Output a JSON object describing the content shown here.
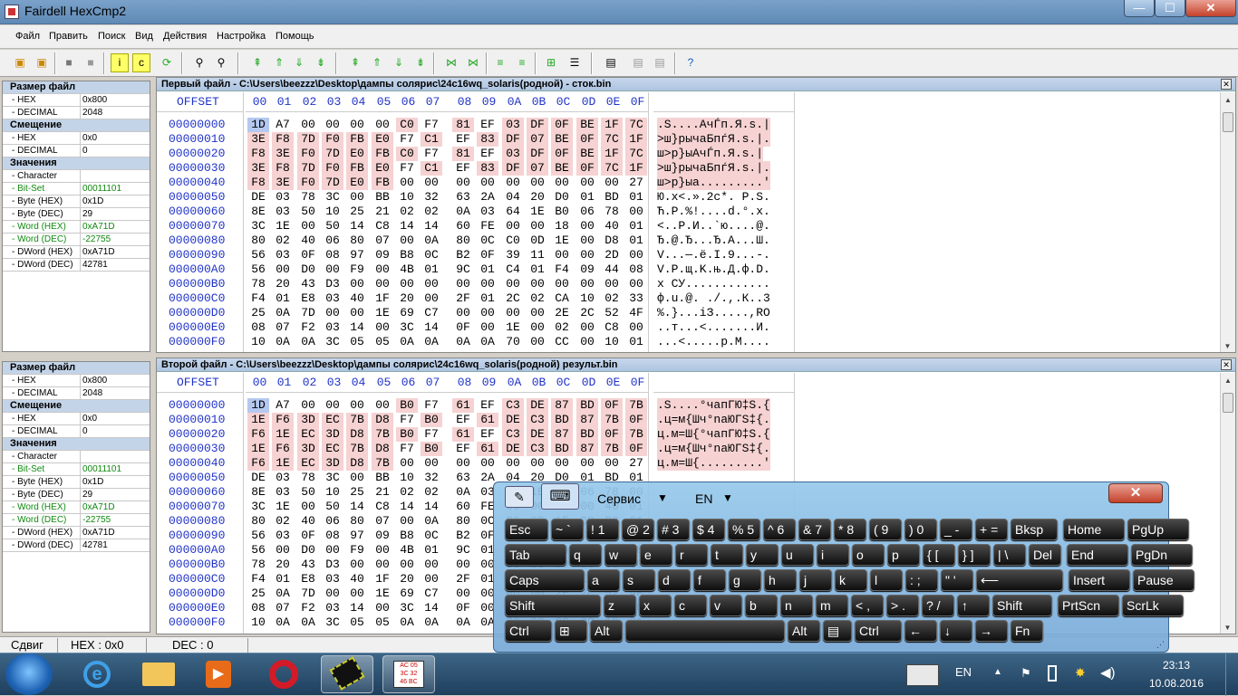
{
  "window": {
    "title": "Fairdell HexCmp2",
    "min": "—",
    "max": "☐",
    "close": "✕"
  },
  "menu": [
    "Файл",
    "Править",
    "Поиск",
    "Вид",
    "Действия",
    "Настройка",
    "Помощь"
  ],
  "left_panel": {
    "rows": [
      {
        "h": "Размер файл"
      },
      {
        "k": "- HEX",
        "v": "0x800"
      },
      {
        "k": "- DECIMAL",
        "v": "2048"
      },
      {
        "h": "Смещение"
      },
      {
        "k": "- HEX",
        "v": "0x0"
      },
      {
        "k": "- DECIMAL",
        "v": "0"
      },
      {
        "h": "Значения"
      },
      {
        "k": "- Character",
        "v": ""
      },
      {
        "k": "- Bit-Set",
        "v": "00011101",
        "green": true
      },
      {
        "k": "- Byte (HEX)",
        "v": "0x1D"
      },
      {
        "k": "- Byte (DEC)",
        "v": "29"
      },
      {
        "k": "- Word (HEX)",
        "v": "0xA71D",
        "green": true
      },
      {
        "k": "- Word (DEC)",
        "v": "-22755",
        "green": true
      },
      {
        "k": "- DWord (HEX)",
        "v": "0xA71D"
      },
      {
        "k": "- DWord (DEC)",
        "v": "42781"
      }
    ]
  },
  "pane1": {
    "caption": "Первый файл - C:\\Users\\beezzz\\Desktop\\дампы солярис\\24c16wq_solaris(родной) - сток.bin",
    "offset_hdr": "OFFSET",
    "cols": [
      "00",
      "01",
      "02",
      "03",
      "04",
      "05",
      "06",
      "07",
      "08",
      "09",
      "0A",
      "0B",
      "0C",
      "0D",
      "0E",
      "0F"
    ],
    "offsets": [
      "00000000",
      "00000010",
      "00000020",
      "00000030",
      "00000040",
      "00000050",
      "00000060",
      "00000070",
      "00000080",
      "00000090",
      "000000A0",
      "000000B0",
      "000000C0",
      "000000D0",
      "000000E0",
      "000000F0"
    ],
    "rows": [
      "1D A7 00 00 00 00 C0 F7 81 EF 03 DF 0F BE 1F 7C",
      "3E F8 7D F0 FB E0 F7 C1 EF 83 DF 07 BE 0F 7C 1F",
      "F8 3E F0 7D E0 FB C0 F7 81 EF 03 DF 0F BE 1F 7C",
      "3E F8 7D F0 FB E0 F7 C1 EF 83 DF 07 BE 0F 7C 1F",
      "F8 3E F0 7D E0 FB 00 00 00 00 00 00 00 00 00 27",
      "DE 03 78 3C 00 BB 10 32 63 2A 04 20 D0 01 BD 01",
      "8E 03 50 10 25 21 02 02 0A 03 64 1E B0 06 78 00",
      "3C 1E 00 50 14 C8 14 14 60 FE 00 00 18 00 40 01",
      "80 02 40 06 80 07 00 0A 80 0C C0 0D 1E 00 D8 01",
      "56 03 0F 08 97 09 B8 0C B2 0F 39 11 00 00 2D 00",
      "56 00 D0 00 F9 00 4B 01 9C 01 C4 01 F4 09 44 08",
      "78 20 43 D3 00 00 00 00 00 00 00 00 00 00 00 00",
      "F4 01 E8 03 40 1F 20 00 2F 01 2C 02 CA 10 02 33",
      "25 0A 7D 00 00 1E 69 C7 00 00 00 00 2E 2C 52 4F",
      "08 07 F2 03 14 00 3C 14 0F 00 1E 00 02 00 C8 00",
      "10 0A 0A 3C 05 05 0A 0A 0A 0A 70 00 CC 00 10 01"
    ],
    "ascii": [
      ".S....АчЃп.Я.s.|",
      ">ш}рычаБпѓЯ.s.|.",
      "ш>р}ыАчЃп.Я.s.|",
      ">ш}рычаБпѓЯ.s.|.",
      "ш>р}ыа.........'",
      "Ю.x<.».2c*. Р.S.",
      "Ћ.Р.%!....d.°.x.",
      "<..Р.И..`ю....@.",
      "Ђ.@.Ђ...Ђ.А...Ш.",
      "V...—.ё.І.9...-.",
      "V.Р.щ.K.њ.Д.ф.D.",
      "x СУ............",
      "ф.u.@. ./.,.К..3",
      "%.}...iЗ.....,RO",
      "..т...<.......И.",
      "...<.....р.М...."
    ]
  },
  "pane2": {
    "caption": "Второй файл - C:\\Users\\beezzz\\Desktop\\дампы солярис\\24c16wq_solaris(родной) результ.bin",
    "offset_hdr": "OFFSET",
    "rows": [
      "1D A7 00 00 00 00 B0 F7 61 EF C3 DE 87 BD 0F 7B",
      "1E F6 3D EC 7B D8 F7 B0 EF 61 DE C3 BD 87 7B 0F",
      "F6 1E EC 3D D8 7B B0 F7 61 EF C3 DE 87 BD 0F 7B",
      "1E F6 3D EC 7B D8 F7 B0 EF 61 DE C3 BD 87 7B 0F",
      "F6 1E EC 3D D8 7B 00 00 00 00 00 00 00 00 00 27",
      "DE 03 78 3C 00 BB 10 32 63 2A 04 20 D0 01 BD 01",
      "8E 03 50 10 25 21 02 02 0A 03 64 1E B0 06 78 00",
      "3C 1E 00 50 14 C8 14 14 60 FE 00 00 18 00 40 01",
      "80 02 40 06 80 07 00 0A 80 0C C0 0D 1E 00 D8 01",
      "56 03 0F 08 97 09 B8 0C B2 0F 39 11 00 00 2D 00",
      "56 00 D0 00 F9 00 4B 01 9C 01 C4 01 F4 09 44 08",
      "78 20 43 D3 00 00 00 00 00 00 00 00 00 00 00 00",
      "F4 01 E8 03 40 1F 20 00 2F 01 2C 02 CA 10 02 33",
      "25 0A 7D 00 00 1E 69 C7 00 00 00 00 2E 2C 52 4F",
      "08 07 F2 03 14 00 3C 14 0F 00 1E 00 02 00 C8 00",
      "10 0A 0A 3C 05 05 0A 0A 0A 0A 70 00 CC 00 10 01"
    ],
    "ascii": [
      ".S....°чaпГЮ‡S.{",
      ".ц=м{Шч°naЮГS‡{.",
      "ц.м=Ш{°чaпГЮ‡S.{",
      ".ц=м{Шч°naЮГS‡{.",
      "ц.м=Ш{.........'"
    ]
  },
  "statusbar": {
    "shift": "Сдвиг",
    "hex": "HEX : 0x0",
    "dec": "DEC : 0"
  },
  "keyboard": {
    "service": "Сервис",
    "lang": "EN",
    "close": "✕",
    "rows": [
      [
        "Esc",
        "~ `",
        "! 1",
        "@ 2",
        "# 3",
        "$ 4",
        "% 5",
        "^ 6",
        "& 7",
        "* 8",
        "( 9",
        ") 0",
        "_ -",
        "+ =",
        "Bksp",
        "Home",
        "PgUp"
      ],
      [
        "Tab",
        "q",
        "w",
        "e",
        "r",
        "t",
        "y",
        "u",
        "i",
        "o",
        "p",
        "{ [",
        "} ]",
        "| \\",
        "Del",
        "End",
        "PgDn"
      ],
      [
        "Caps",
        "a",
        "s",
        "d",
        "f",
        "g",
        "h",
        "j",
        "k",
        "l",
        ": ;",
        "\" '",
        "⟵",
        "Insert",
        "Pause"
      ],
      [
        "Shift",
        "z",
        "x",
        "c",
        "v",
        "b",
        "n",
        "m",
        "< ,",
        "> .",
        "? /",
        "↑",
        "Shift",
        "PrtScn",
        "ScrLk"
      ],
      [
        "Ctrl",
        "⊞",
        "Alt",
        "",
        "Alt",
        "▤",
        "Ctrl",
        "←",
        "↓",
        "→",
        "Fn"
      ]
    ]
  },
  "taskbar": {
    "lang": "EN",
    "time": "23:13",
    "date": "10.08.2016"
  }
}
